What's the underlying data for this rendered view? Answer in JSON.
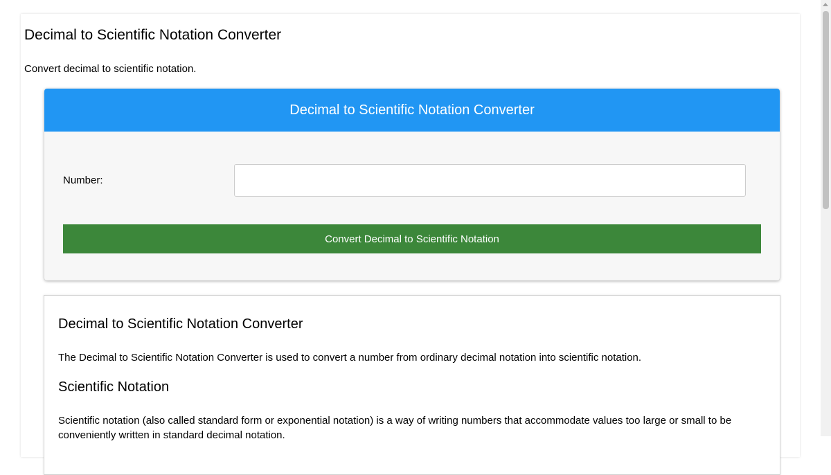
{
  "page": {
    "title": "Decimal to Scientific Notation Converter",
    "subtitle": "Convert decimal to scientific notation."
  },
  "calculator": {
    "header": "Decimal to Scientific Notation Converter",
    "number_label": "Number:",
    "number_value": "",
    "convert_label": "Convert Decimal to Scientific Notation"
  },
  "info": {
    "title": "Decimal to Scientific Notation Converter",
    "intro": "The Decimal to Scientific Notation Converter is used to convert a number from ordinary decimal notation into scientific notation.",
    "section_title": "Scientific Notation",
    "section_text": "Scientific notation (also called standard form or exponential notation) is a way of writing numbers that accommodate values too large or small to be conveniently written in standard decimal notation."
  },
  "colors": {
    "header_bg": "#2196f3",
    "button_bg": "#3c873a",
    "card_bg": "#f7f7f7"
  }
}
